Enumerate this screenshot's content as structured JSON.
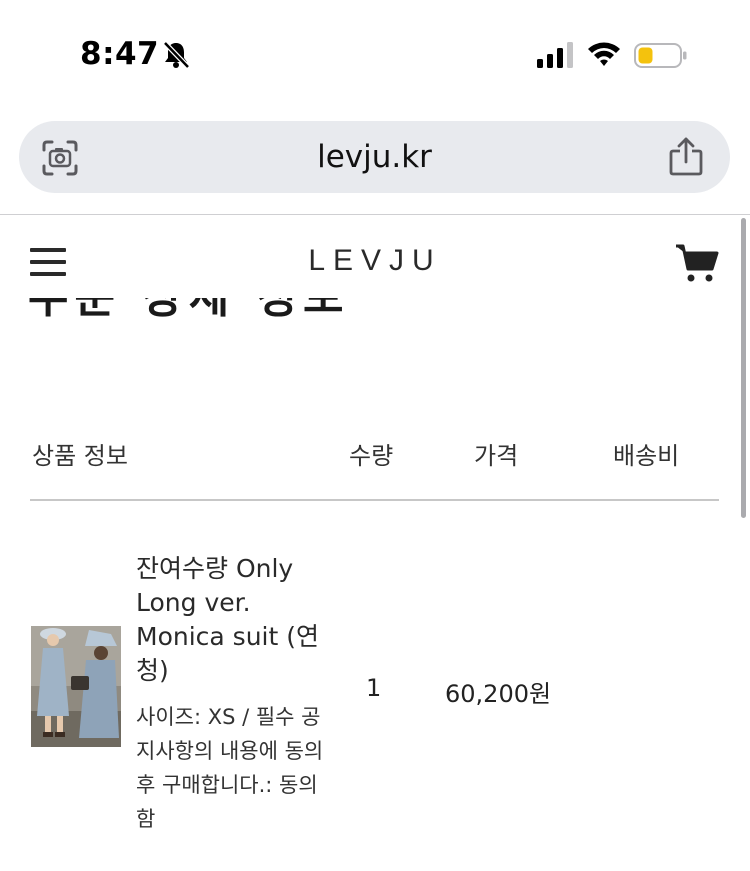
{
  "status_bar": {
    "time": "8:47"
  },
  "browser": {
    "url": "levju.kr"
  },
  "site": {
    "logo": "LEVJU",
    "partial_heading": "주문 상세 정보"
  },
  "order_table": {
    "headers": {
      "product": "상품 정보",
      "quantity": "수량",
      "price": "가격",
      "shipping": "배송비"
    },
    "items": [
      {
        "name": "잔여수량 Only Long ver. Monica suit (연청)",
        "option": "사이즈: XS / 필수 공지사항의 내용에 동의 후 구매합니다.: 동의함",
        "quantity": "1",
        "price": "60,200원"
      }
    ]
  },
  "colors": {
    "url_bar_bg": "#e8eaee",
    "battery_fill": "#f4c20d",
    "text_primary": "#2a2a2a",
    "divider": "#c7c7c7"
  },
  "icons": [
    "bell-slash-icon",
    "signal-icon",
    "wifi-icon",
    "battery-icon",
    "lens-icon",
    "share-icon",
    "hamburger-menu-icon",
    "cart-icon"
  ]
}
